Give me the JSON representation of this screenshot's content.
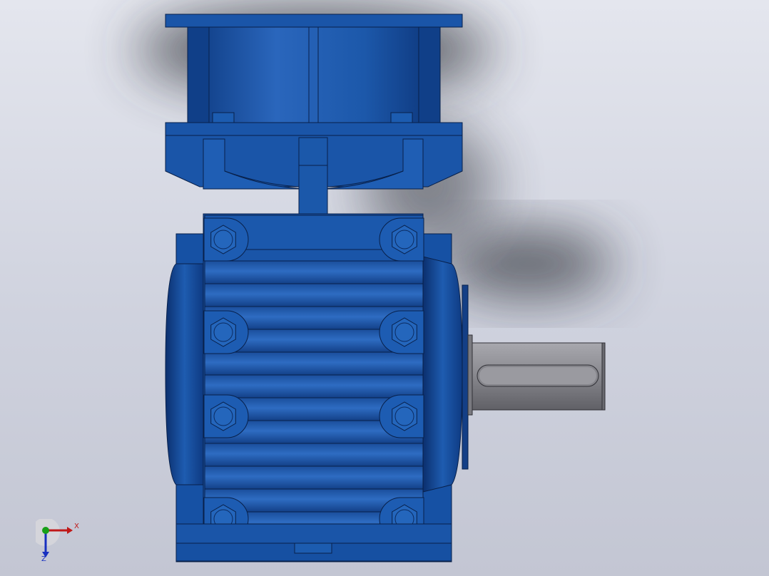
{
  "viewport": {
    "background_top": "#e4e6ee",
    "background_bottom": "#c3c6d3"
  },
  "model": {
    "body_color": "#1a55a8",
    "body_dark": "#0d3a80",
    "body_light": "#2a6cc4",
    "edge_color": "#08204a",
    "shaft_color": "#8c8c92",
    "shadow_color": "#3a3c44"
  },
  "triad": {
    "x_label": "X",
    "z_label": "Z",
    "x_color": "#c01818",
    "y_color": "#18a018",
    "z_color": "#1830c0"
  }
}
